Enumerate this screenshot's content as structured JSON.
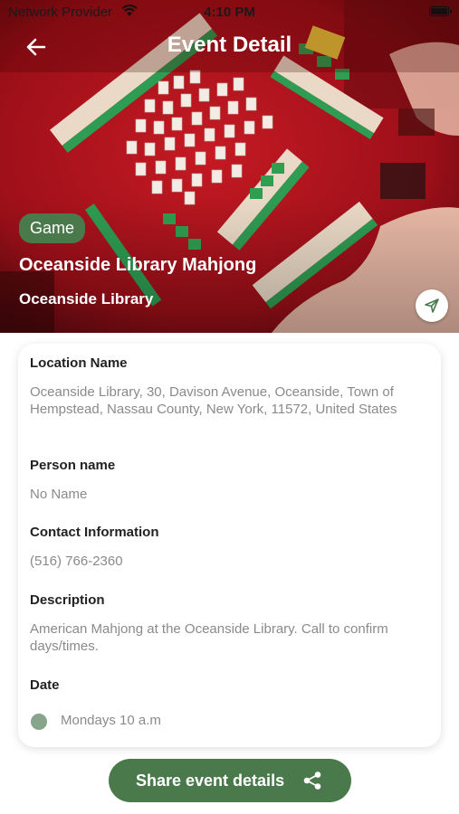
{
  "status_bar": {
    "carrier": "Network Provider",
    "time": "4:10 PM"
  },
  "header": {
    "title": "Event Detail",
    "icons": [
      "back-arrow-icon",
      "navigate-icon"
    ]
  },
  "event": {
    "category": "Game",
    "title": "Oceanside Library Mahjong",
    "venue": "Oceanside Library"
  },
  "details": {
    "location_label": "Location Name",
    "location_value": "Oceanside Library, 30, Davison Avenue, Oceanside, Town of Hempstead, Nassau County, New York, 11572, United States",
    "person_label": "Person name",
    "person_value": "No Name",
    "contact_label": "Contact Information",
    "contact_value": "(516) 766-2360",
    "description_label": "Description",
    "description_value": "American Mahjong at the Oceanside Library.  Call to confirm days/times.",
    "date_label": "Date",
    "date_value": "Mondays 10 a.m"
  },
  "actions": {
    "share_label": "Share event details",
    "share_icon": "share-icon"
  },
  "colors": {
    "accent_green": "#4a7a4c",
    "date_dot": "#86a58a",
    "hero_red": "#a8121c"
  }
}
